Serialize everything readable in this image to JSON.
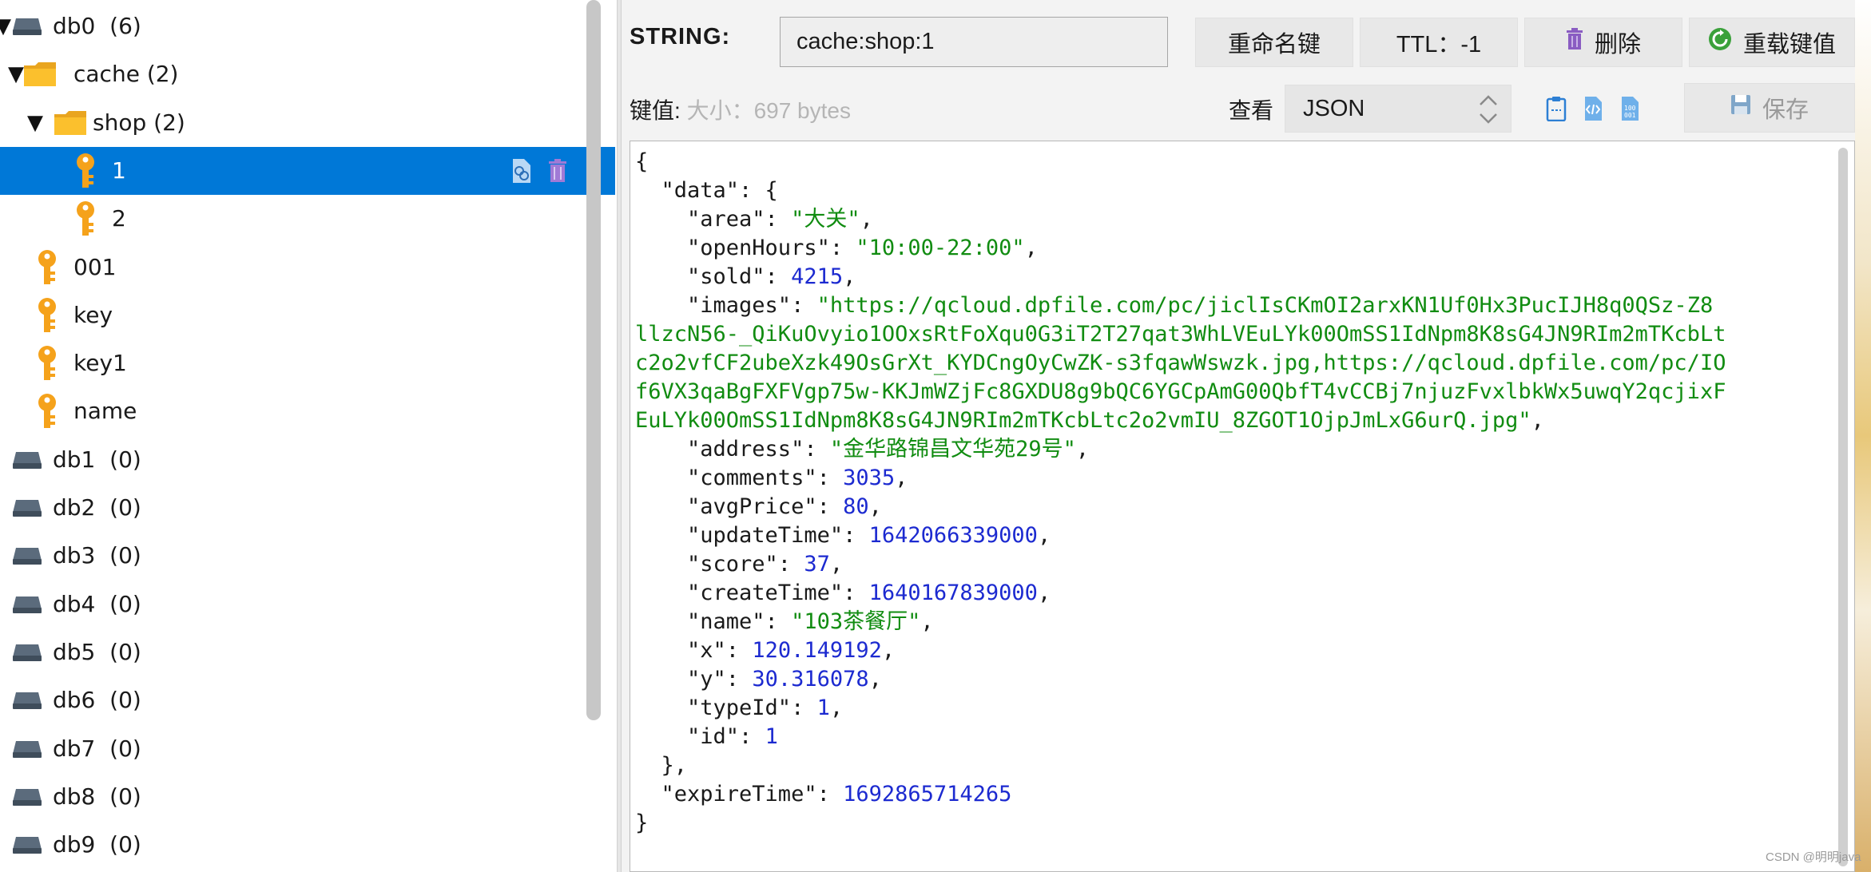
{
  "tree": {
    "rows": [
      {
        "kind": "db",
        "label": "db0",
        "count": "(6)",
        "expanded": true
      },
      {
        "kind": "folder",
        "label": "cache (2)",
        "expanded": true
      },
      {
        "kind": "folder",
        "label": "shop (2)",
        "expanded": true
      },
      {
        "kind": "key",
        "label": "1",
        "selected": true
      },
      {
        "kind": "key",
        "label": "2"
      },
      {
        "kind": "key",
        "label": "001"
      },
      {
        "kind": "key",
        "label": "key"
      },
      {
        "kind": "key",
        "label": "key1"
      },
      {
        "kind": "key",
        "label": "name"
      },
      {
        "kind": "db",
        "label": "db1",
        "count": "(0)"
      },
      {
        "kind": "db",
        "label": "db2",
        "count": "(0)"
      },
      {
        "kind": "db",
        "label": "db3",
        "count": "(0)"
      },
      {
        "kind": "db",
        "label": "db4",
        "count": "(0)"
      },
      {
        "kind": "db",
        "label": "db5",
        "count": "(0)"
      },
      {
        "kind": "db",
        "label": "db6",
        "count": "(0)"
      },
      {
        "kind": "db",
        "label": "db7",
        "count": "(0)"
      },
      {
        "kind": "db",
        "label": "db8",
        "count": "(0)"
      },
      {
        "kind": "db",
        "label": "db9",
        "count": "(0)"
      }
    ],
    "selected_row_icons": [
      "copy-link-icon",
      "trash-icon"
    ]
  },
  "detail": {
    "type_label": "STRING:",
    "key_name": "cache:shop:1",
    "rename_label": "重命名键",
    "ttl_label": "TTL：-1",
    "delete_label": "删除",
    "reload_label": "重载键值",
    "value_label": "键值:",
    "size_label": "大小：697 bytes",
    "view_label": "查看",
    "format_value": "JSON",
    "save_label": "保存",
    "toolbar_icons": [
      "clipboard-icon",
      "code-icon",
      "binary-icon"
    ]
  },
  "editor": {
    "lines": [
      "{",
      "  \"data\": {",
      "    \"area\": \"大关\",",
      "    \"openHours\": \"10:00-22:00\",",
      "    \"sold\": 4215,",
      "    \"images\": \"https://qcloud.dpfile.com/pc/jiclIsCKmOI2arxKN1Uf0Hx3PucIJH8q0QSz-Z8llzcN56-_QiKuOvyio1OOxsRtFoXqu0G3iT2T27qat3WhLVEuLYk00OmSS1IdNpm8K8sG4JN9RIm2mTKcbLtc2o2vfCF2ubeXzk49OsGrXt_KYDCngOyCwZK-s3fqawWswzk.jpg,https://qcloud.dpfile.com/pc/IOf6VX3qaBgFXFVgp75w-KKJmWZjFc8GXDU8g9bQC6YGCpAmG00QbfT4vCCBj7njuzFvxlbkWx5uwqY2qcjixFEuLYk00OmSS1IdNpm8K8sG4JN9RIm2mTKcbLtc2o2vmIU_8ZGOT1OjpJmLxG6urQ.jpg\",",
      "    \"address\": \"金华路锦昌文华苑29号\",",
      "    \"comments\": 3035,",
      "    \"avgPrice\": 80,",
      "    \"updateTime\": 1642066339000,",
      "    \"score\": 37,",
      "    \"createTime\": 1640167839000,",
      "    \"name\": \"103茶餐厅\",",
      "    \"x\": 120.149192,",
      "    \"y\": 30.316078,",
      "    \"typeId\": 1,",
      "    \"id\": 1",
      "  },",
      "  \"expireTime\": 1692865714265",
      "}"
    ],
    "string_color": "#118c11",
    "number_color": "#1c2ad0"
  },
  "colors": {
    "selection": "#0078d7",
    "key_icon": "#f5a21b",
    "folder_icon": "#f7b733",
    "db_icon": "#4a5a6a",
    "delete_icon": "#8a5cc2",
    "reload_icon": "#3aa13a"
  },
  "watermark": "CSDN @明明java"
}
